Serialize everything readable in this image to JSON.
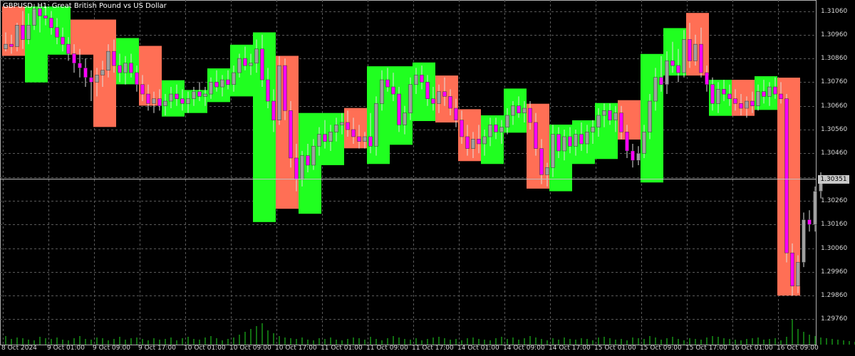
{
  "title": "GBPUSD, H1: Great British Pound vs US Dollar",
  "current_price": "1.30351",
  "price_labels": [
    "1.31060",
    "1.30960",
    "1.30860",
    "1.30760",
    "1.30660",
    "1.30560",
    "1.30460",
    "1.30260",
    "1.30160",
    "1.30060",
    "1.29960",
    "1.29860",
    "1.29760"
  ],
  "time_labels": [
    "8 Oct 2024",
    "9 Oct 01:00",
    "9 Oct 09:00",
    "9 Oct 17:00",
    "10 Oct 01:00",
    "10 Oct 09:00",
    "10 Oct 17:00",
    "11 Oct 01:00",
    "11 Oct 09:00",
    "11 Oct 17:00",
    "14 Oct 01:00",
    "14 Oct 09:00",
    "14 Oct 17:00",
    "15 Oct 01:00",
    "15 Oct 09:00",
    "15 Oct 17:00",
    "16 Oct 01:00",
    "16 Oct 09:00"
  ],
  "colors": {
    "background": "#000000",
    "grid": "#5a5a5a",
    "bull_box": "#20ff20",
    "bear_box": "#ff6f55",
    "candle_up": "#a0a0a0",
    "candle_down": "#ff00ff",
    "wick": "#ffffff",
    "volume": "#22dd22",
    "price_line": "#c0c0c0"
  },
  "chart_data": {
    "type": "candlestick",
    "symbol": "GBPUSD",
    "timeframe": "H1",
    "title": "GBPUSD, H1: Great British Pound vs US Dollar",
    "ylim": [
      1.2972,
      1.3112
    ],
    "current_price": 1.30351,
    "grid": true,
    "boxes": [
      {
        "from": 0,
        "to": 3,
        "high": 1.31079,
        "low": 1.30871,
        "dir": "bear"
      },
      {
        "from": 4,
        "to": 7,
        "high": 1.31079,
        "low": 1.30759,
        "dir": "bull"
      },
      {
        "from": 8,
        "to": 11,
        "high": 1.31079,
        "low": 1.30876,
        "dir": "bull"
      },
      {
        "from": 12,
        "to": 15,
        "high": 1.31024,
        "low": 1.30876,
        "dir": "bear"
      },
      {
        "from": 16,
        "to": 19,
        "high": 1.31024,
        "low": 1.30571,
        "dir": "bear"
      },
      {
        "from": 20,
        "to": 23,
        "high": 1.30946,
        "low": 1.30751,
        "dir": "bull"
      },
      {
        "from": 24,
        "to": 27,
        "high": 1.30913,
        "low": 1.30661,
        "dir": "bear"
      },
      {
        "from": 28,
        "to": 31,
        "high": 1.30768,
        "low": 1.30615,
        "dir": "bull"
      },
      {
        "from": 32,
        "to": 35,
        "high": 1.30727,
        "low": 1.3063,
        "dir": "bull"
      },
      {
        "from": 36,
        "to": 39,
        "high": 1.30818,
        "low": 1.30676,
        "dir": "bull"
      },
      {
        "from": 40,
        "to": 43,
        "high": 1.30918,
        "low": 1.307,
        "dir": "bull"
      },
      {
        "from": 44,
        "to": 47,
        "high": 1.3097,
        "low": 1.3017,
        "dir": "bull"
      },
      {
        "from": 48,
        "to": 51,
        "high": 1.30871,
        "low": 1.30226,
        "dir": "bear"
      },
      {
        "from": 52,
        "to": 55,
        "high": 1.3063,
        "low": 1.30205,
        "dir": "bull"
      },
      {
        "from": 56,
        "to": 59,
        "high": 1.3063,
        "low": 1.3041,
        "dir": "bull"
      },
      {
        "from": 60,
        "to": 63,
        "high": 1.30651,
        "low": 1.30481,
        "dir": "bear"
      },
      {
        "from": 64,
        "to": 67,
        "high": 1.30827,
        "low": 1.30415,
        "dir": "bull"
      },
      {
        "from": 68,
        "to": 71,
        "high": 1.30827,
        "low": 1.30496,
        "dir": "bull"
      },
      {
        "from": 72,
        "to": 75,
        "high": 1.30843,
        "low": 1.30596,
        "dir": "bull"
      },
      {
        "from": 76,
        "to": 79,
        "high": 1.30788,
        "low": 1.3059,
        "dir": "bear"
      },
      {
        "from": 80,
        "to": 83,
        "high": 1.30646,
        "low": 1.30427,
        "dir": "bear"
      },
      {
        "from": 84,
        "to": 87,
        "high": 1.3062,
        "low": 1.30415,
        "dir": "bull"
      },
      {
        "from": 88,
        "to": 91,
        "high": 1.30733,
        "low": 1.30547,
        "dir": "bull"
      },
      {
        "from": 92,
        "to": 95,
        "high": 1.30669,
        "low": 1.30311,
        "dir": "bear"
      },
      {
        "from": 96,
        "to": 99,
        "high": 1.30581,
        "low": 1.303,
        "dir": "bull"
      },
      {
        "from": 100,
        "to": 103,
        "high": 1.30599,
        "low": 1.30415,
        "dir": "bull"
      },
      {
        "from": 104,
        "to": 107,
        "high": 1.30672,
        "low": 1.30436,
        "dir": "bull"
      },
      {
        "from": 108,
        "to": 111,
        "high": 1.30684,
        "low": 1.30518,
        "dir": "bear"
      },
      {
        "from": 112,
        "to": 115,
        "high": 1.30879,
        "low": 1.30337,
        "dir": "bull"
      },
      {
        "from": 116,
        "to": 119,
        "high": 1.30988,
        "low": 1.30788,
        "dir": "bull"
      },
      {
        "from": 120,
        "to": 123,
        "high": 1.31052,
        "low": 1.30788,
        "dir": "bear"
      },
      {
        "from": 124,
        "to": 127,
        "high": 1.3077,
        "low": 1.30618,
        "dir": "bull"
      },
      {
        "from": 128,
        "to": 131,
        "high": 1.3077,
        "low": 1.30618,
        "dir": "bear"
      },
      {
        "from": 132,
        "to": 135,
        "high": 1.30785,
        "low": 1.30643,
        "dir": "bull"
      },
      {
        "from": 136,
        "to": 139,
        "high": 1.30779,
        "low": 1.2986,
        "dir": "bear"
      }
    ],
    "candles": [
      [
        1.309,
        1.3097,
        1.3089,
        1.3092
      ],
      [
        1.3092,
        1.3096,
        1.3088,
        1.3091
      ],
      [
        1.3091,
        1.3101,
        1.3089,
        1.31
      ],
      [
        1.31,
        1.3106,
        1.309,
        1.3094
      ],
      [
        1.3094,
        1.3105,
        1.3092,
        1.31
      ],
      [
        1.31,
        1.3109,
        1.3098,
        1.3107
      ],
      [
        1.3107,
        1.3108,
        1.3097,
        1.3104
      ],
      [
        1.3104,
        1.3108,
        1.31,
        1.3103
      ],
      [
        1.3103,
        1.3106,
        1.3096,
        1.3099
      ],
      [
        1.3099,
        1.3103,
        1.3092,
        1.3095
      ],
      [
        1.3095,
        1.3099,
        1.3089,
        1.3092
      ],
      [
        1.3092,
        1.3095,
        1.3085,
        1.3088
      ],
      [
        1.3088,
        1.3092,
        1.308,
        1.3084
      ],
      [
        1.3084,
        1.309,
        1.3078,
        1.3082
      ],
      [
        1.3082,
        1.3086,
        1.3074,
        1.3078
      ],
      [
        1.3078,
        1.3081,
        1.3068,
        1.3076
      ],
      [
        1.3076,
        1.3082,
        1.307,
        1.3079
      ],
      [
        1.3079,
        1.3085,
        1.3074,
        1.3081
      ],
      [
        1.3081,
        1.3092,
        1.3078,
        1.3089
      ],
      [
        1.3089,
        1.3094,
        1.308,
        1.3083
      ],
      [
        1.3083,
        1.3088,
        1.3076,
        1.308
      ],
      [
        1.308,
        1.3087,
        1.3075,
        1.3084
      ],
      [
        1.3084,
        1.3088,
        1.3078,
        1.308
      ],
      [
        1.308,
        1.3083,
        1.3072,
        1.3075
      ],
      [
        1.3075,
        1.3079,
        1.3068,
        1.3071
      ],
      [
        1.3071,
        1.3075,
        1.3064,
        1.3067
      ],
      [
        1.3067,
        1.3072,
        1.3063,
        1.3069
      ],
      [
        1.3069,
        1.3073,
        1.3064,
        1.3066
      ],
      [
        1.3066,
        1.3071,
        1.3062,
        1.3068
      ],
      [
        1.3068,
        1.3074,
        1.3065,
        1.3071
      ],
      [
        1.3071,
        1.3075,
        1.3066,
        1.3069
      ],
      [
        1.3069,
        1.3073,
        1.3064,
        1.3067
      ],
      [
        1.3067,
        1.3072,
        1.3063,
        1.3069
      ],
      [
        1.3069,
        1.3074,
        1.3066,
        1.3072
      ],
      [
        1.3072,
        1.3076,
        1.3068,
        1.307
      ],
      [
        1.307,
        1.3074,
        1.3066,
        1.3071
      ],
      [
        1.3071,
        1.3078,
        1.3069,
        1.3076
      ],
      [
        1.3076,
        1.3081,
        1.3072,
        1.3074
      ],
      [
        1.3074,
        1.3079,
        1.307,
        1.3077
      ],
      [
        1.3077,
        1.3081,
        1.3073,
        1.3075
      ],
      [
        1.3075,
        1.3083,
        1.3072,
        1.308
      ],
      [
        1.308,
        1.3088,
        1.3078,
        1.3086
      ],
      [
        1.3086,
        1.3091,
        1.3081,
        1.3083
      ],
      [
        1.3083,
        1.3088,
        1.3079,
        1.3084
      ],
      [
        1.3084,
        1.3094,
        1.308,
        1.309
      ],
      [
        1.309,
        1.3096,
        1.3074,
        1.3077
      ],
      [
        1.3077,
        1.3082,
        1.3065,
        1.3068
      ],
      [
        1.3068,
        1.3073,
        1.3055,
        1.306
      ],
      [
        1.306,
        1.3087,
        1.3058,
        1.3083
      ],
      [
        1.3083,
        1.3086,
        1.306,
        1.3064
      ],
      [
        1.3064,
        1.3068,
        1.304,
        1.3044
      ],
      [
        1.3044,
        1.305,
        1.303,
        1.3035
      ],
      [
        1.3035,
        1.3047,
        1.3032,
        1.3045
      ],
      [
        1.3045,
        1.305,
        1.3038,
        1.3041
      ],
      [
        1.3041,
        1.3052,
        1.3039,
        1.3049
      ],
      [
        1.3049,
        1.3057,
        1.3045,
        1.3054
      ],
      [
        1.3054,
        1.306,
        1.3048,
        1.3051
      ],
      [
        1.3051,
        1.3058,
        1.3047,
        1.3055
      ],
      [
        1.3055,
        1.3061,
        1.3051,
        1.3058
      ],
      [
        1.3058,
        1.3063,
        1.3054,
        1.3059
      ],
      [
        1.3059,
        1.3064,
        1.3053,
        1.3056
      ],
      [
        1.3056,
        1.3061,
        1.305,
        1.3053
      ],
      [
        1.3053,
        1.3058,
        1.3048,
        1.3051
      ],
      [
        1.3051,
        1.3055,
        1.3048,
        1.3053
      ],
      [
        1.3053,
        1.3063,
        1.3046,
        1.3049
      ],
      [
        1.3049,
        1.307,
        1.3045,
        1.3067
      ],
      [
        1.3067,
        1.3081,
        1.3064,
        1.3077
      ],
      [
        1.3077,
        1.3082,
        1.3072,
        1.3074
      ],
      [
        1.3074,
        1.308,
        1.3068,
        1.3071
      ],
      [
        1.3071,
        1.3074,
        1.3055,
        1.3058
      ],
      [
        1.3058,
        1.3066,
        1.3054,
        1.3063
      ],
      [
        1.3063,
        1.3078,
        1.306,
        1.3075
      ],
      [
        1.3075,
        1.3082,
        1.3071,
        1.3079
      ],
      [
        1.3079,
        1.3083,
        1.3073,
        1.3076
      ],
      [
        1.3076,
        1.3079,
        1.3066,
        1.3069
      ],
      [
        1.3069,
        1.3074,
        1.3064,
        1.3067
      ],
      [
        1.3067,
        1.3075,
        1.3063,
        1.3072
      ],
      [
        1.3072,
        1.3078,
        1.3066,
        1.307
      ],
      [
        1.307,
        1.3073,
        1.3062,
        1.3065
      ],
      [
        1.3065,
        1.3069,
        1.3057,
        1.306
      ],
      [
        1.306,
        1.3064,
        1.305,
        1.3053
      ],
      [
        1.3053,
        1.3058,
        1.3045,
        1.3048
      ],
      [
        1.3048,
        1.3055,
        1.3044,
        1.3052
      ],
      [
        1.3052,
        1.3058,
        1.3046,
        1.305
      ],
      [
        1.305,
        1.3056,
        1.3045,
        1.3053
      ],
      [
        1.3053,
        1.3061,
        1.3049,
        1.3058
      ],
      [
        1.3058,
        1.3061,
        1.3052,
        1.3055
      ],
      [
        1.3055,
        1.306,
        1.305,
        1.3057
      ],
      [
        1.3057,
        1.3065,
        1.3054,
        1.3062
      ],
      [
        1.3062,
        1.3068,
        1.3058,
        1.3066
      ],
      [
        1.3066,
        1.307,
        1.3061,
        1.3063
      ],
      [
        1.3063,
        1.3068,
        1.3059,
        1.3065
      ],
      [
        1.3065,
        1.3068,
        1.3056,
        1.3059
      ],
      [
        1.3059,
        1.3063,
        1.3045,
        1.3048
      ],
      [
        1.3048,
        1.3052,
        1.3033,
        1.3037
      ],
      [
        1.3037,
        1.3042,
        1.3032,
        1.304
      ],
      [
        1.304,
        1.3058,
        1.3036,
        1.3054
      ],
      [
        1.3054,
        1.3057,
        1.3044,
        1.3047
      ],
      [
        1.3047,
        1.3056,
        1.3043,
        1.3053
      ],
      [
        1.3053,
        1.3057,
        1.3046,
        1.3049
      ],
      [
        1.3049,
        1.3056,
        1.3045,
        1.3054
      ],
      [
        1.3054,
        1.3059,
        1.3047,
        1.305
      ],
      [
        1.305,
        1.3058,
        1.3046,
        1.3055
      ],
      [
        1.3055,
        1.306,
        1.305,
        1.3057
      ],
      [
        1.3057,
        1.3065,
        1.3053,
        1.3062
      ],
      [
        1.3062,
        1.3067,
        1.3057,
        1.3064
      ],
      [
        1.3064,
        1.3067,
        1.3058,
        1.306
      ],
      [
        1.306,
        1.3066,
        1.3055,
        1.3063
      ],
      [
        1.3063,
        1.3066,
        1.3052,
        1.3055
      ],
      [
        1.3055,
        1.3058,
        1.3044,
        1.3047
      ],
      [
        1.3047,
        1.305,
        1.304,
        1.3043
      ],
      [
        1.3043,
        1.3049,
        1.3041,
        1.3046
      ],
      [
        1.3046,
        1.3058,
        1.3044,
        1.3055
      ],
      [
        1.3055,
        1.3071,
        1.3052,
        1.3068
      ],
      [
        1.3068,
        1.3082,
        1.3064,
        1.3078
      ],
      [
        1.3078,
        1.3087,
        1.3072,
        1.3075
      ],
      [
        1.3075,
        1.3089,
        1.3071,
        1.3085
      ],
      [
        1.3085,
        1.3093,
        1.308,
        1.3083
      ],
      [
        1.3083,
        1.309,
        1.3076,
        1.308
      ],
      [
        1.308,
        1.3098,
        1.3078,
        1.3094
      ],
      [
        1.3094,
        1.3101,
        1.3082,
        1.3085
      ],
      [
        1.3085,
        1.3096,
        1.3083,
        1.3092
      ],
      [
        1.3092,
        1.3099,
        1.3078,
        1.308
      ],
      [
        1.308,
        1.3083,
        1.3072,
        1.3075
      ],
      [
        1.3075,
        1.3078,
        1.3064,
        1.3067
      ],
      [
        1.3067,
        1.3076,
        1.3063,
        1.3073
      ],
      [
        1.3073,
        1.3077,
        1.3068,
        1.3071
      ],
      [
        1.3071,
        1.3075,
        1.3066,
        1.3069
      ],
      [
        1.3069,
        1.3073,
        1.3064,
        1.3067
      ],
      [
        1.3067,
        1.3071,
        1.3062,
        1.3065
      ],
      [
        1.3065,
        1.307,
        1.3061,
        1.3068
      ],
      [
        1.3068,
        1.3072,
        1.3063,
        1.3066
      ],
      [
        1.3066,
        1.3075,
        1.3064,
        1.3072
      ],
      [
        1.3072,
        1.3077,
        1.3067,
        1.307
      ],
      [
        1.307,
        1.3076,
        1.3066,
        1.3074
      ],
      [
        1.3074,
        1.3078,
        1.3069,
        1.3071
      ],
      [
        1.3071,
        1.3076,
        1.3067,
        1.3069
      ],
      [
        1.3069,
        1.3071,
        1.3,
        1.3004
      ],
      [
        1.3004,
        1.3008,
        1.2986,
        1.299
      ],
      [
        1.299,
        1.3003,
        1.2987,
        1.3
      ],
      [
        1.3,
        1.3021,
        1.2998,
        1.3018
      ],
      [
        1.3018,
        1.3022,
        1.3013,
        1.3016
      ],
      [
        1.3016,
        1.3032,
        1.3013,
        1.303
      ],
      [
        1.303,
        1.3038,
        1.3027,
        1.3035
      ]
    ],
    "volume": [
      12,
      8,
      10,
      9,
      7,
      6,
      11,
      9,
      8,
      10,
      7,
      6,
      9,
      12,
      8,
      7,
      10,
      9,
      6,
      8,
      11,
      7,
      9,
      10,
      8,
      6,
      9,
      7,
      8,
      10,
      6,
      9,
      11,
      8,
      7,
      10,
      12,
      9,
      6,
      8,
      10,
      14,
      18,
      22,
      26,
      30,
      20,
      16,
      12,
      10,
      9,
      8,
      10,
      7,
      6,
      9,
      8,
      10,
      7,
      6,
      8,
      10,
      9,
      7,
      11,
      8,
      6,
      9,
      12,
      10,
      8,
      7,
      9,
      6,
      8,
      10,
      11,
      9,
      7,
      8,
      6,
      9,
      10,
      8,
      7,
      6,
      9,
      11,
      8,
      10,
      7,
      9,
      12,
      10,
      8,
      6,
      9,
      7,
      10,
      8,
      7,
      9,
      8,
      6,
      10,
      11,
      9,
      7,
      8,
      6,
      10,
      9,
      8,
      12,
      10,
      7,
      9,
      11,
      8,
      6,
      9,
      8,
      7,
      10,
      12,
      11,
      9,
      8,
      7,
      6,
      8,
      9,
      10,
      7,
      8,
      9,
      6,
      11,
      35,
      22,
      18,
      14,
      12,
      10,
      9,
      8,
      7,
      6,
      5,
      4
    ]
  }
}
